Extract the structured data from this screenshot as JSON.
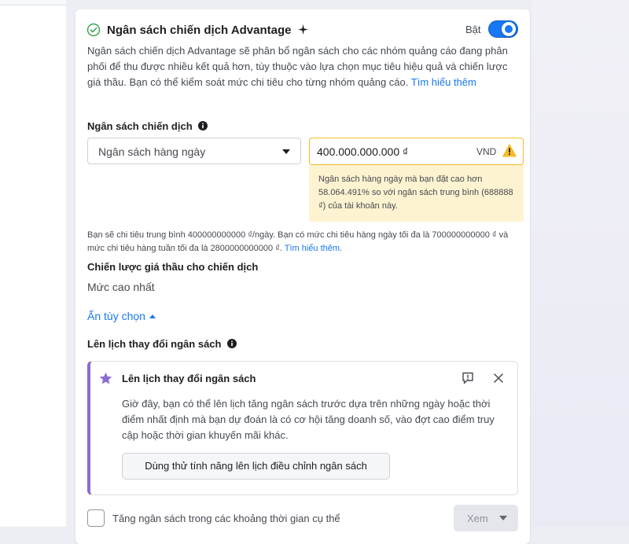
{
  "campaign_budget": {
    "title": "Ngân sách chiến dịch Advantage",
    "toggle_label": "Bật",
    "toggle_on": true,
    "description": "Ngân sách chiến dịch Advantage sẽ phân bổ ngân sách cho các nhóm quảng cáo đang phân phối để thu được nhiều kết quả hơn, tùy thuộc vào lựa chọn mục tiêu hiệu quả và chiến lược giá thầu. Bạn có thể kiểm soát mức chi tiêu cho từng nhóm quảng cáo.",
    "learn_more": "Tìm hiểu thêm"
  },
  "budget": {
    "label": "Ngân sách chiến dịch",
    "type_selected": "Ngân sách hàng ngày",
    "amount": "400.000.000.000 ₫",
    "currency": "VND",
    "warning": "Ngân sách hàng ngày mà bạn đặt cao hơn 58.064.491% so với ngân sách trung bình (688888 ₫) của tài khoản này.",
    "note": "Bạn sẽ chi tiêu trung bình 400000000000 ₫/ngày. Bạn có mức chi tiêu hàng ngày tối đa là 700000000000 ₫ và mức chi tiêu hàng tuần tối đa là 2800000000000 ₫.",
    "note_link": "Tìm hiểu thêm."
  },
  "bid_strategy": {
    "label": "Chiến lược giá thầu cho chiến dịch",
    "value": "Mức cao nhất"
  },
  "hide_options": "Ẩn tùy chọn",
  "schedule": {
    "label": "Lên lịch thay đổi ngân sách",
    "card_title": "Lên lịch thay đổi ngân sách",
    "card_text": "Giờ đây, bạn có thể lên lịch tăng ngân sách trước dựa trên những ngày hoặc thời điểm nhất định mà bạn dự đoán là có cơ hội tăng doanh số, vào đợt cao điểm truy cập hoặc thời gian khuyến mãi khác.",
    "try_button": "Dùng thử tính năng lên lịch điều chỉnh ngân sách",
    "checkbox_label": "Tăng ngân sách trong các khoảng thời gian cụ thể",
    "view_button": "Xem"
  },
  "colors": {
    "accent": "#1877f2",
    "warning_border": "#f7b928",
    "warning_bg": "#fef3d0",
    "card_accent": "#8c6bd4"
  }
}
